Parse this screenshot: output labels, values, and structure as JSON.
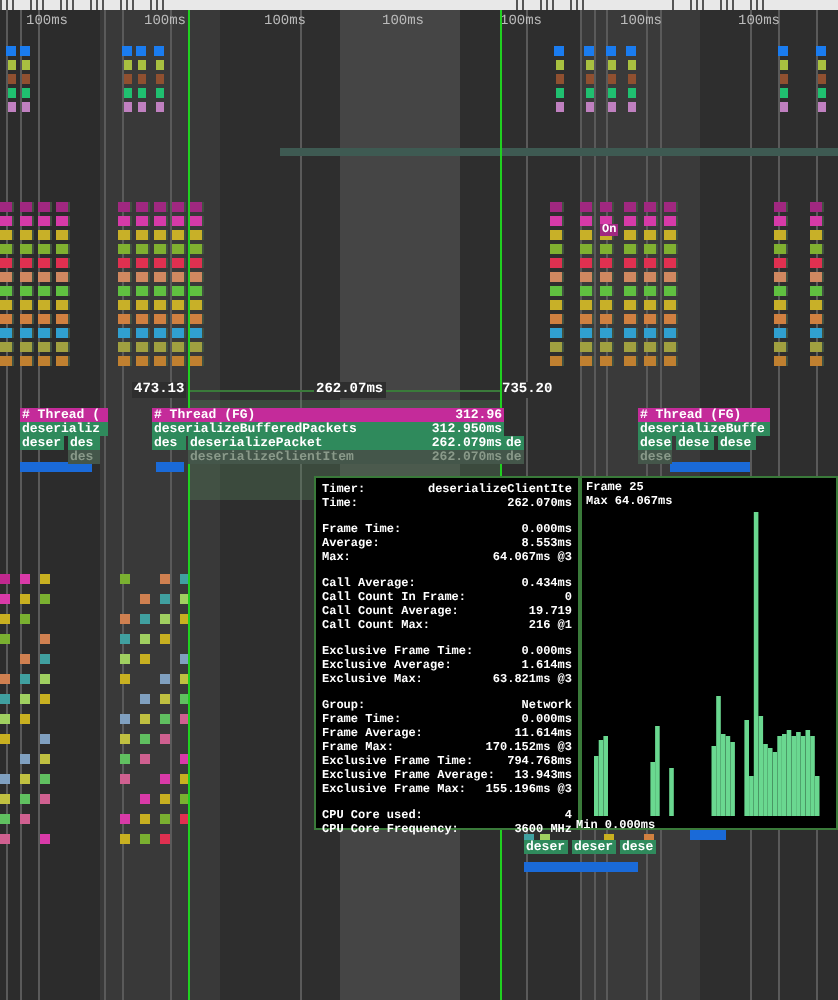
{
  "ruler": {
    "labels": [
      "100ms",
      "100ms",
      "100ms",
      "100ms",
      "100ms",
      "100ms",
      "100ms"
    ]
  },
  "marker": {
    "label": "On"
  },
  "selection": {
    "start": "473.13",
    "duration": "262.07ms",
    "end": "735.20"
  },
  "bars": [
    {
      "kind": "thread",
      "label": "# Thread ("
    },
    {
      "kind": "event",
      "label": "deserializ"
    },
    {
      "kind": "event",
      "label": "deser"
    },
    {
      "kind": "event",
      "label": "des"
    },
    {
      "kind": "dim",
      "label": "des"
    },
    {
      "kind": "thread",
      "label": "# Thread (FG)",
      "time": "312.96"
    },
    {
      "kind": "event",
      "label": "deserializeBufferedPackets",
      "time": "312.950ms"
    },
    {
      "kind": "event",
      "label": "des"
    },
    {
      "kind": "event",
      "label": "deserializePacket",
      "time": "262.079ms"
    },
    {
      "kind": "event",
      "label": "de"
    },
    {
      "kind": "dim",
      "label": "deserializeClientItem",
      "time": "262.070ms"
    },
    {
      "kind": "dim",
      "label": "de"
    },
    {
      "kind": "thread",
      "label": "# Thread (FG)"
    },
    {
      "kind": "event",
      "label": "deserializeBuffe"
    },
    {
      "kind": "event",
      "label": "dese"
    },
    {
      "kind": "event",
      "label": "dese"
    },
    {
      "kind": "event",
      "label": "dese"
    },
    {
      "kind": "dim",
      "label": "dese"
    },
    {
      "kind": "event",
      "label": "deser"
    },
    {
      "kind": "event",
      "label": "deser"
    },
    {
      "kind": "event",
      "label": "dese"
    }
  ],
  "tooltip": {
    "sections": [
      [
        {
          "key": "Timer:",
          "value": "deserializeClientIte"
        },
        {
          "key": "Time:",
          "value": "262.070ms"
        }
      ],
      [
        {
          "key": "Frame Time:",
          "value": "0.000ms"
        },
        {
          "key": "Average:",
          "value": "8.553ms"
        },
        {
          "key": "Max:",
          "value": "64.067ms @3"
        }
      ],
      [
        {
          "key": "Call Average:",
          "value": "0.434ms"
        },
        {
          "key": "Call Count In Frame:",
          "value": "0"
        },
        {
          "key": "Call Count Average:",
          "value": "19.719"
        },
        {
          "key": "Call Count Max:",
          "value": "216 @1"
        }
      ],
      [
        {
          "key": "Exclusive Frame Time:",
          "value": "0.000ms"
        },
        {
          "key": "Exclusive Average:",
          "value": "1.614ms"
        },
        {
          "key": "Exclusive Max:",
          "value": "63.821ms @3"
        }
      ],
      [
        {
          "key": "Group:",
          "value": "Network"
        },
        {
          "key": "Frame Time:",
          "value": "0.000ms"
        },
        {
          "key": "Frame Average:",
          "value": "11.614ms"
        },
        {
          "key": "Frame Max:",
          "value": "170.152ms @3"
        },
        {
          "key": "Exclusive Frame Time:",
          "value": "794.768ms"
        },
        {
          "key": "Exclusive Frame Average:",
          "value": "13.943ms"
        },
        {
          "key": "Exclusive Frame Max:",
          "value": "155.196ms @3"
        }
      ],
      [
        {
          "key": "CPU Core used:",
          "value": "4"
        },
        {
          "key": "CPU Core Frequency:",
          "value": "3600 MHz"
        }
      ]
    ]
  },
  "graph": {
    "frame": "Frame 25",
    "max": "Max 64.067ms",
    "min": "Min 0.000ms"
  }
}
